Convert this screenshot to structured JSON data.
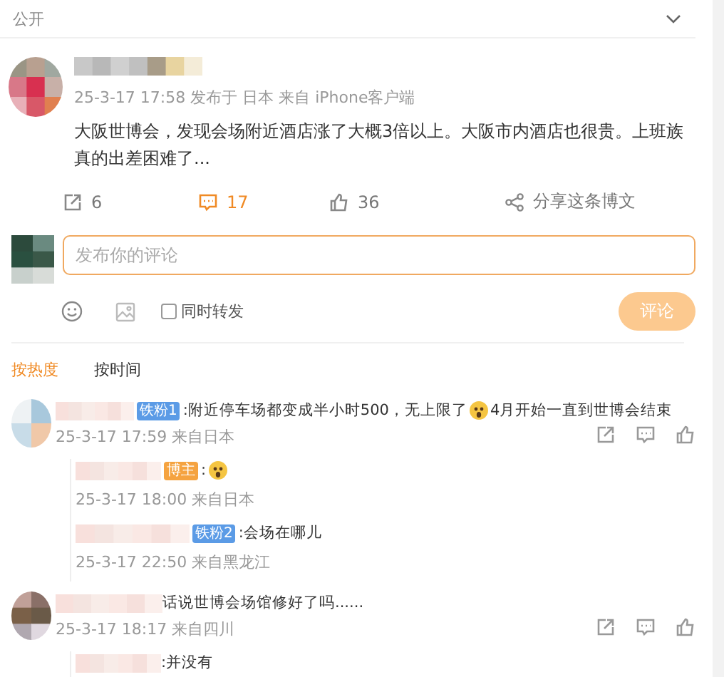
{
  "visibility": "公开",
  "post": {
    "meta": "25-3-17 17:58 发布于 日本 来自 iPhone客户端",
    "text": "大阪世博会，发现会场附近酒店涨了大概3倍以上。大阪市内酒店也很贵。上班族真的出差困难了...",
    "actions": [
      {
        "kind": "forward",
        "count": "6",
        "selected": false
      },
      {
        "kind": "comment",
        "count": "17",
        "selected": true
      },
      {
        "kind": "like",
        "count": "36",
        "selected": false
      },
      {
        "kind": "share",
        "count": "分享这条博文",
        "selected": false
      }
    ]
  },
  "composer": {
    "placeholder": "发布你的评论",
    "repost_label": "同时转发",
    "repost_checked": false,
    "submit": "评论",
    "submit_disabled": true
  },
  "sort_tabs": [
    {
      "label": "按热度",
      "selected": true
    },
    {
      "label": "按时间",
      "selected": false
    }
  ],
  "comments": [
    {
      "badge": "铁粉1",
      "color": "#5b9be6",
      "segments": [
        {
          "kind": "text",
          "text": ":附近停车场都变成半小时500，无上限了"
        },
        {
          "kind": "emoji"
        },
        {
          "kind": "text",
          "text": "4月开始一直到世博会结束"
        }
      ],
      "meta": "25-3-17 17:59 来自日本",
      "replies": [
        {
          "badge": "博主",
          "color": "#f5a340",
          "segments": [
            {
              "kind": "text",
              "text": ":"
            },
            {
              "kind": "emoji"
            }
          ],
          "meta": "25-3-17 18:00 来自日本"
        },
        {
          "badge": "铁粉2",
          "color": "#5b9be6",
          "segments": [
            {
              "kind": "text",
              "text": ":会场在哪儿"
            }
          ],
          "meta": "25-3-17 22:50 来自黑龙江"
        }
      ]
    },
    {
      "segments": [
        {
          "kind": "text",
          "text": "话说世博会场馆修好了吗......"
        }
      ],
      "meta": "25-3-17 18:17 来自四川",
      "replies": [
        {
          "segments": [
            {
              "kind": "text",
              "text": ":并没有"
            }
          ]
        }
      ]
    }
  ]
}
